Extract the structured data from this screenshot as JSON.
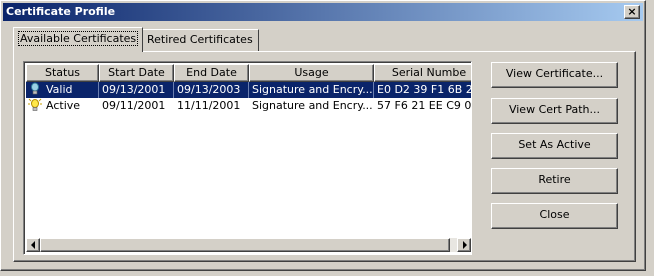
{
  "window": {
    "title": "Certificate Profile",
    "close_glyph": "×"
  },
  "tabs": [
    {
      "label": "Available Certificates",
      "active": true
    },
    {
      "label": "Retired Certificates",
      "active": false
    }
  ],
  "table": {
    "columns": [
      "Status",
      "Start Date",
      "End Date",
      "Usage",
      "Serial Numbe"
    ],
    "rows": [
      {
        "status": "Valid",
        "start": "09/13/2001",
        "end": "09/13/2003",
        "usage": "Signature and Encry...",
        "serial": "E0 D2 39 F1 6B 2",
        "selected": true,
        "icon": "lightbulb-icon"
      },
      {
        "status": "Active",
        "start": "09/11/2001",
        "end": "11/11/2001",
        "usage": "Signature and Encry...",
        "serial": "57 F6 21 EE C9 0",
        "selected": false,
        "icon": "lightbulb-lit-icon"
      }
    ]
  },
  "buttons": {
    "view_certificate": "View Certificate...",
    "view_cert_path": "View Cert Path...",
    "set_as_active": "Set As Active",
    "retire": "Retire",
    "close": "Close"
  },
  "colors": {
    "titlebar_start": "#0a246a",
    "titlebar_end": "#a6caf0",
    "selection": "#0a246a",
    "face": "#d4d0c8"
  }
}
